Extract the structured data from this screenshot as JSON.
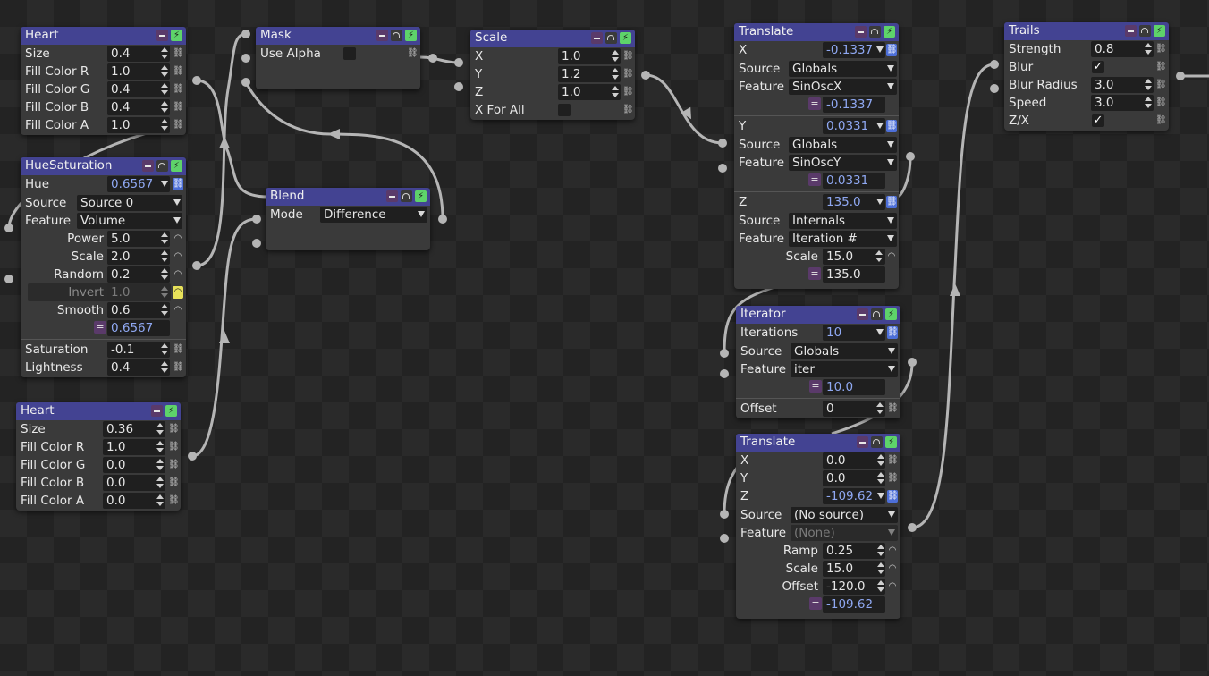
{
  "nodes": {
    "heart1": {
      "title": "Heart",
      "rows": [
        {
          "label": "Size",
          "value": "0.4"
        },
        {
          "label": "Fill Color R",
          "value": "1.0"
        },
        {
          "label": "Fill Color G",
          "value": "0.4"
        },
        {
          "label": "Fill Color B",
          "value": "0.4"
        },
        {
          "label": "Fill Color A",
          "value": "1.0"
        }
      ]
    },
    "huesat": {
      "title": "HueSaturation",
      "hue": {
        "label": "Hue",
        "value": "0.6567"
      },
      "source": {
        "label": "Source",
        "value": "Source 0"
      },
      "feature": {
        "label": "Feature",
        "value": "Volume"
      },
      "power": {
        "label": "Power",
        "value": "5.0"
      },
      "scale": {
        "label": "Scale",
        "value": "2.0"
      },
      "random": {
        "label": "Random",
        "value": "0.2"
      },
      "invert": {
        "label": "Invert",
        "value": "1.0"
      },
      "smooth": {
        "label": "Smooth",
        "value": "0.6"
      },
      "result": "0.6567",
      "saturation": {
        "label": "Saturation",
        "value": "-0.1"
      },
      "lightness": {
        "label": "Lightness",
        "value": "0.4"
      }
    },
    "heart2": {
      "title": "Heart",
      "rows": [
        {
          "label": "Size",
          "value": "0.36"
        },
        {
          "label": "Fill Color R",
          "value": "1.0"
        },
        {
          "label": "Fill Color G",
          "value": "0.0"
        },
        {
          "label": "Fill Color B",
          "value": "0.0"
        },
        {
          "label": "Fill Color A",
          "value": "0.0"
        }
      ]
    },
    "mask": {
      "title": "Mask",
      "use_alpha": "Use Alpha"
    },
    "blend": {
      "title": "Blend",
      "mode_label": "Mode",
      "mode_value": "Difference"
    },
    "scale": {
      "title": "Scale",
      "rows": [
        {
          "label": "X",
          "value": "1.0"
        },
        {
          "label": "Y",
          "value": "1.2"
        },
        {
          "label": "Z",
          "value": "1.0"
        }
      ],
      "xforall": "X For All"
    },
    "translate1": {
      "title": "Translate",
      "x": {
        "label": "X",
        "value": "-0.1337",
        "source": "Globals",
        "feature": "SinOscX",
        "result": "-0.1337"
      },
      "y": {
        "label": "Y",
        "value": "0.0331",
        "source": "Globals",
        "feature": "SinOscY",
        "result": "0.0331"
      },
      "z": {
        "label": "Z",
        "value": "135.0",
        "source": "Internals",
        "feature": "Iteration #",
        "scale_label": "Scale",
        "scale_value": "15.0",
        "result": "135.0"
      },
      "source_label": "Source",
      "feature_label": "Feature"
    },
    "iterator": {
      "title": "Iterator",
      "iterations": {
        "label": "Iterations",
        "value": "10"
      },
      "source": {
        "label": "Source",
        "value": "Globals"
      },
      "feature": {
        "label": "Feature",
        "value": "iter"
      },
      "result": "10.0",
      "offset": {
        "label": "Offset",
        "value": "0"
      }
    },
    "translate2": {
      "title": "Translate",
      "x": {
        "label": "X",
        "value": "0.0"
      },
      "y": {
        "label": "Y",
        "value": "0.0"
      },
      "z": {
        "label": "Z",
        "value": "-109.62"
      },
      "source": {
        "label": "Source",
        "value": "(No source)"
      },
      "feature": {
        "label": "Feature",
        "value": "(None)"
      },
      "ramp": {
        "label": "Ramp",
        "value": "0.25"
      },
      "scale": {
        "label": "Scale",
        "value": "15.0"
      },
      "offset": {
        "label": "Offset",
        "value": "-120.0"
      },
      "result": "-109.62"
    },
    "trails": {
      "title": "Trails",
      "strength": {
        "label": "Strength",
        "value": "0.8"
      },
      "blur": {
        "label": "Blur"
      },
      "blur_radius": {
        "label": "Blur Radius",
        "value": "3.0"
      },
      "speed": {
        "label": "Speed",
        "value": "3.0"
      },
      "zx": {
        "label": "Z/X"
      }
    }
  },
  "colors": {
    "header": "#434392",
    "node": "#3a3a3a",
    "field": "#1f1f1f",
    "link_active": "#4d6fd8",
    "bolt": "#5ed36a",
    "wire": "#b8b8b8"
  }
}
